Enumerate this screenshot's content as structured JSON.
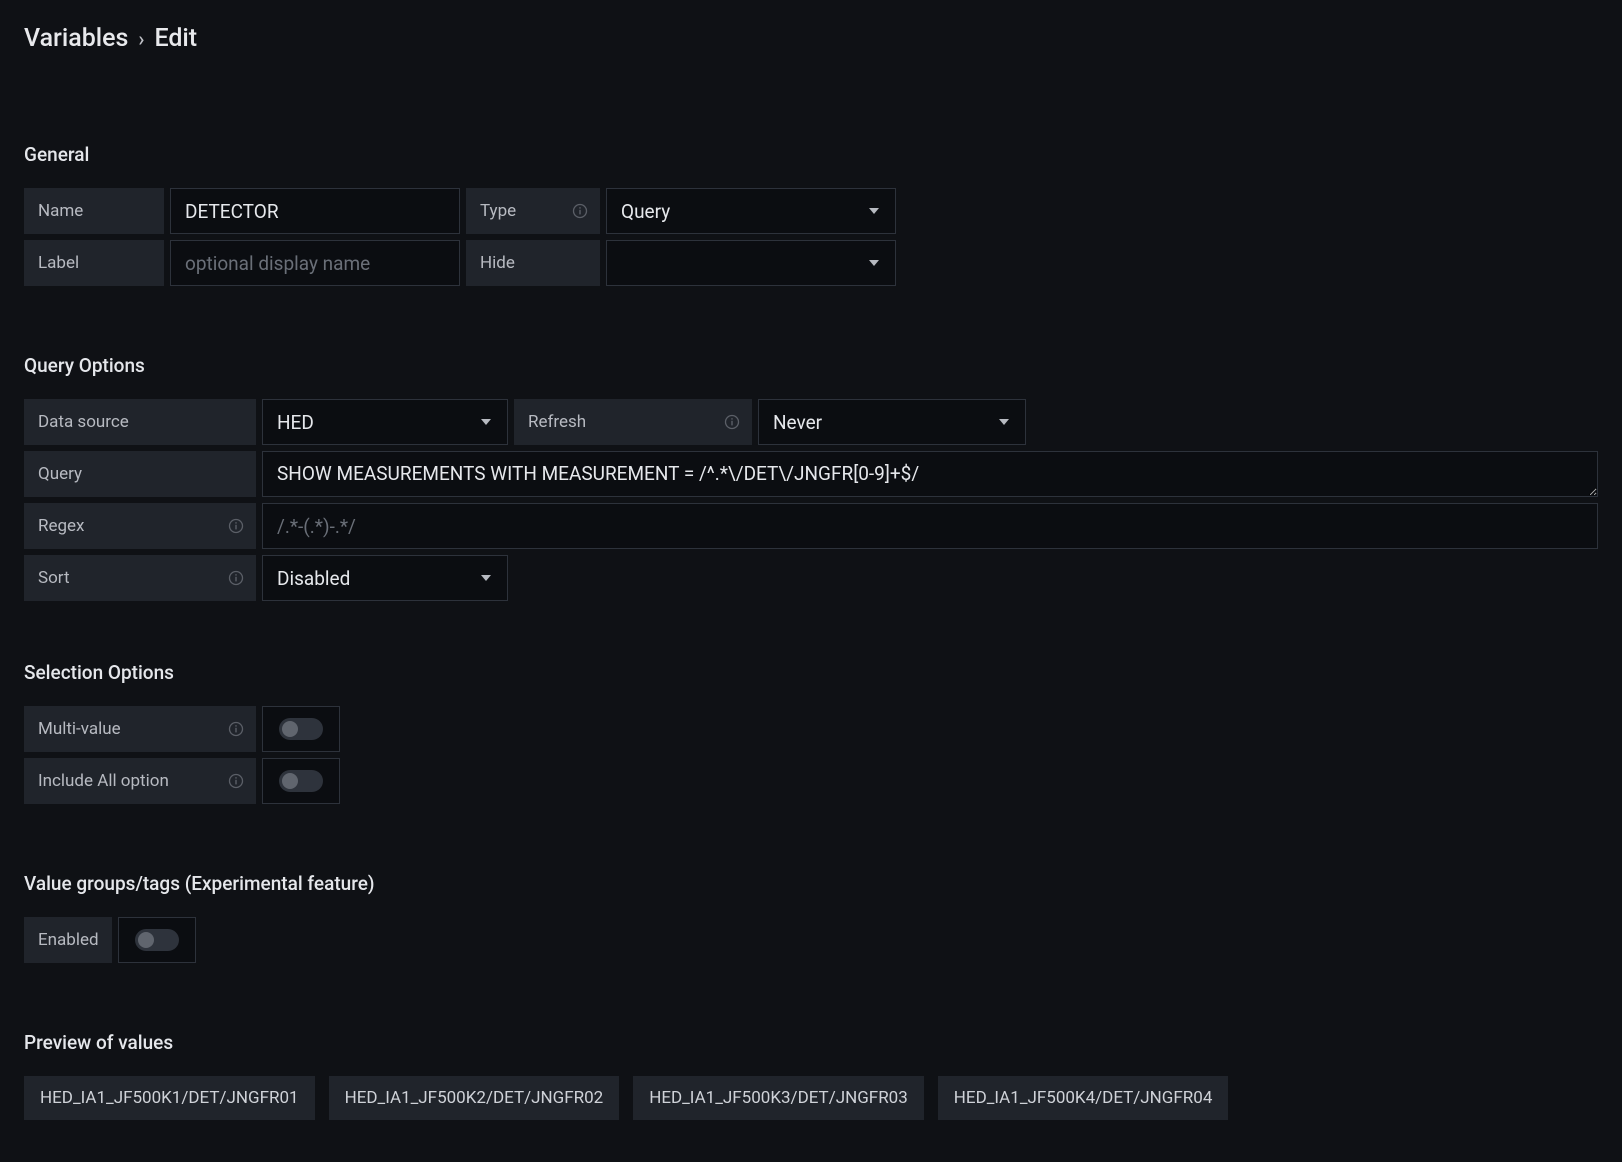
{
  "breadcrumb": {
    "root": "Variables",
    "current": "Edit"
  },
  "general": {
    "title": "General",
    "name_label": "Name",
    "name_value": "DETECTOR",
    "label_label": "Label",
    "label_placeholder": "optional display name",
    "label_value": "",
    "type_label": "Type",
    "type_value": "Query",
    "hide_label": "Hide",
    "hide_value": ""
  },
  "queryOptions": {
    "title": "Query Options",
    "datasource_label": "Data source",
    "datasource_value": "HED",
    "refresh_label": "Refresh",
    "refresh_value": "Never",
    "query_label": "Query",
    "query_value": "SHOW MEASUREMENTS WITH MEASUREMENT = /^.*\\/DET\\/JNGFR[0-9]+$/",
    "regex_label": "Regex",
    "regex_placeholder": "/.*-(.*)-.*/",
    "regex_value": "",
    "sort_label": "Sort",
    "sort_value": "Disabled"
  },
  "selectionOptions": {
    "title": "Selection Options",
    "multi_label": "Multi-value",
    "multi_value": false,
    "includeall_label": "Include All option",
    "includeall_value": false
  },
  "valueGroups": {
    "title": "Value groups/tags (Experimental feature)",
    "enabled_label": "Enabled",
    "enabled_value": false
  },
  "preview": {
    "title": "Preview of values",
    "values": [
      "HED_IA1_JF500K1/DET/JNGFR01",
      "HED_IA1_JF500K2/DET/JNGFR02",
      "HED_IA1_JF500K3/DET/JNGFR03",
      "HED_IA1_JF500K4/DET/JNGFR04"
    ]
  }
}
